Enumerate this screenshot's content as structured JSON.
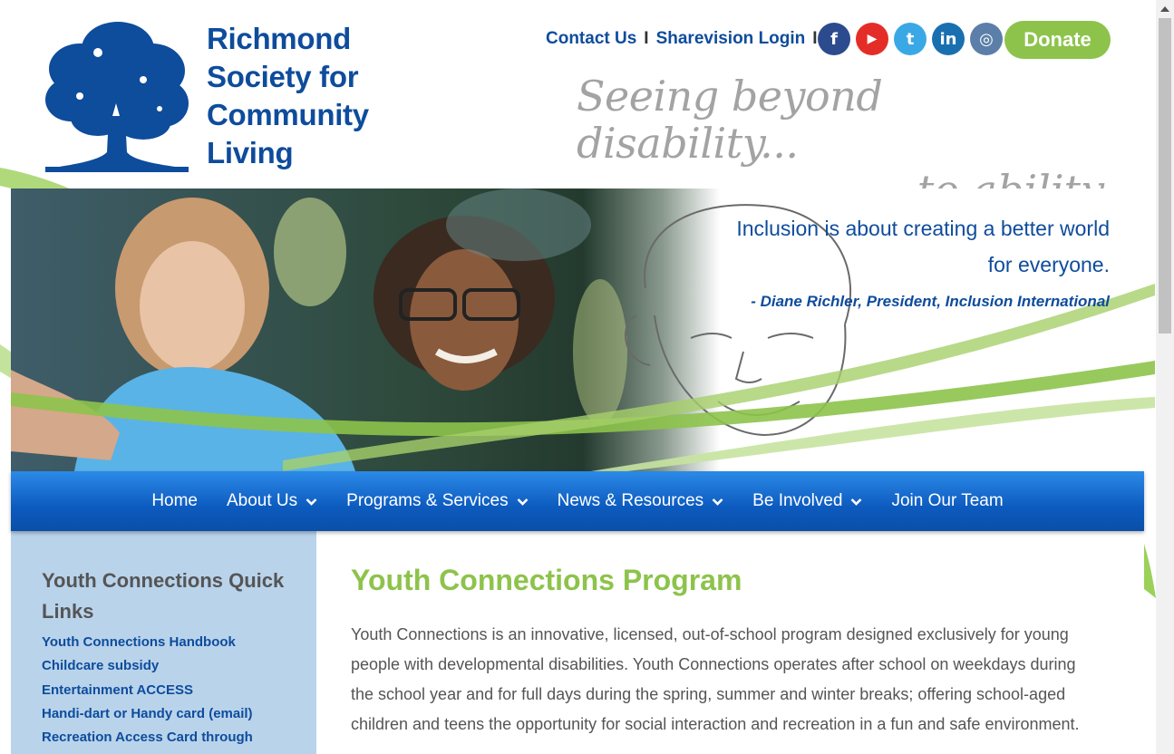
{
  "org": {
    "logo_lines": [
      "Richmond",
      "Society for",
      "Community",
      "Living"
    ]
  },
  "toplinks": {
    "contact": "Contact Us",
    "login": "Sharevision Login",
    "separator": "I"
  },
  "socials": [
    {
      "name": "facebook-icon",
      "glyph": "f"
    },
    {
      "name": "youtube-icon",
      "glyph": "▶"
    },
    {
      "name": "twitter-icon",
      "glyph": "t"
    },
    {
      "name": "linkedin-icon",
      "glyph": "in"
    },
    {
      "name": "instagram-icon",
      "glyph": "◎"
    }
  ],
  "donate_label": "Donate",
  "tagline": {
    "line1": "Seeing beyond disability...",
    "line2": "to ability"
  },
  "hero": {
    "quote": "Inclusion is about creating a better world for everyone.",
    "attribution": "- Diane Richler, President, Inclusion International"
  },
  "nav": {
    "home": "Home",
    "about": "About Us",
    "programs": "Programs & Services",
    "news": "News & Resources",
    "involved": "Be Involved",
    "join": "Join Our Team"
  },
  "sidebar": {
    "title": "Youth Connections Quick Links",
    "links": [
      "Youth Connections Handbook",
      "Childcare subsidy",
      "Entertainment ACCESS",
      "Handi-dart or Handy card (email)",
      "Recreation Access Card through"
    ]
  },
  "main": {
    "title": "Youth Connections Program",
    "body": "Youth Connections is an innovative, licensed, out-of-school program designed exclusively for young people with developmental disabilities. Youth Connections operates after school on weekdays during the school year and for full days during the spring, summer and winter breaks; offering school-aged children and teens the opportunity for social interaction and recreation in a fun and safe environment."
  },
  "colors": {
    "brand_blue": "#0e4c9c",
    "accent_green": "#8dc34b",
    "nav_blue": "#0d5bbf",
    "sidebar_bg": "#b9d3eb"
  }
}
